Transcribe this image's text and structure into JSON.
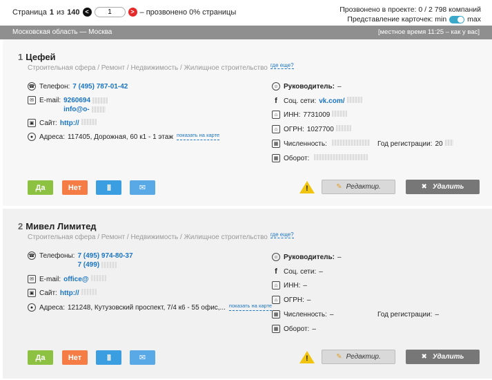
{
  "pager": {
    "prefix": "Страница",
    "current": "1",
    "of": "из",
    "total": "140",
    "prev_label": "<",
    "next_label": ">",
    "input_value": "1",
    "progress_text": "– прозвонено 0% страницы"
  },
  "top_right": {
    "called_text": "Прозвонено в проекте:  0 / 2 798 компаний",
    "view_label": "Представление карточек: min",
    "view_max": "max",
    "view_mode": "max"
  },
  "region": {
    "name": "Московская область — Москва",
    "time": "[местное время 11:25 – как у вас]"
  },
  "cards": [
    {
      "num": "1",
      "name": "Цефей",
      "category": "Строительная сфера / Ремонт / Недвижимость  /  Жилищное строительство",
      "more": "где еще?",
      "phone_label": "Телефон:",
      "phones": [
        "7 (495) 787-01-42"
      ],
      "email_label": "E-mail:",
      "emails": [
        "9260694",
        "info@o-"
      ],
      "site_label": "Сайт:",
      "site": "http://",
      "address_label": "Адреса:",
      "address": "117405, Дорожная, 60 к1 - 1 этаж",
      "map_link": "показать на карте",
      "head_label": "Руководитель:",
      "head": "–",
      "social_label": "Соц. сети:",
      "social": "vk.com/",
      "inn_label": "ИНН:",
      "inn": "7731009",
      "ogrn_label": "ОГРН:",
      "ogrn": "1027700",
      "staff_label": "Численность:",
      "staff": "",
      "reg_label": "Год регистрации:",
      "reg": "20",
      "turnover_label": "Оборот:",
      "turnover": ""
    },
    {
      "num": "2",
      "name": "Мивел Лимитед",
      "category": "Строительная сфера / Ремонт / Недвижимость  /  Жилищное строительство",
      "more": "где еще?",
      "phone_label": "Телефоны:",
      "phones": [
        "7 (495) 974-80-37",
        "7 (499)"
      ],
      "email_label": "E-mail:",
      "emails": [
        "office@"
      ],
      "site_label": "Сайт:",
      "site": "http://",
      "address_label": "Адреса:",
      "address": "121248, Кутузовский проспект, 7/4 к6 - 55 офис,...",
      "map_link": "показать на карте",
      "head_label": "Руководитель:",
      "head": "–",
      "social_label": "Соц. сети:",
      "social": "–",
      "inn_label": "ИНН:",
      "inn": "–",
      "ogrn_label": "ОГРН:",
      "ogrn": "–",
      "staff_label": "Численность:",
      "staff": "–",
      "reg_label": "Год регистрации:",
      "reg": "–",
      "turnover_label": "Оборот:",
      "turnover": "–"
    }
  ],
  "buttons": {
    "yes": "Да",
    "no": "Нет",
    "pause": "II",
    "edit": "Редактир.",
    "delete": "Удалить"
  },
  "colors": {
    "accent_blue": "#1a74c4",
    "yes_green": "#8cc142",
    "no_orange": "#f57d45",
    "pause_blue": "#3b9ee0",
    "region_gray": "#8f8f8f",
    "warning_yellow": "#f1c40f"
  },
  "icons": [
    "phone-icon",
    "mail-icon",
    "site-icon",
    "location-icon",
    "user-icon",
    "facebook-icon",
    "building-icon",
    "calendar-icon",
    "warning-icon",
    "edit-pencil-icon",
    "close-x-icon",
    "envelope-icon"
  ]
}
